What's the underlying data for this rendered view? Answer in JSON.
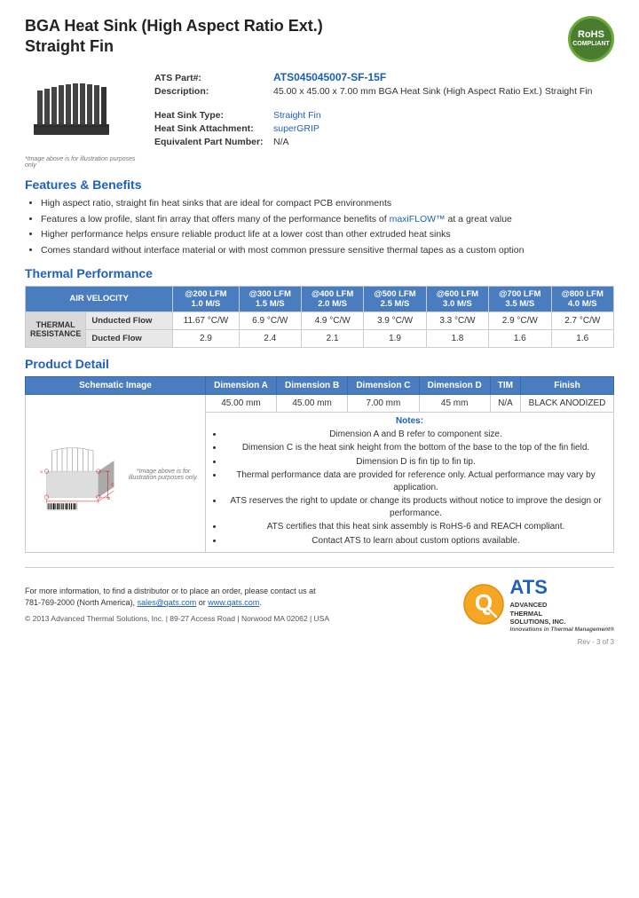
{
  "page": {
    "title_line1": "BGA Heat Sink (High Aspect Ratio Ext.)",
    "title_line2": "Straight Fin"
  },
  "rohs": {
    "line1": "RoHS",
    "line2": "COMPLIANT"
  },
  "product": {
    "part_label": "ATS Part#:",
    "part_number": "ATS045045007-SF-15F",
    "desc_label": "Description:",
    "description": "45.00 x 45.00 x 7.00 mm  BGA Heat Sink (High Aspect Ratio Ext.) Straight Fin",
    "type_label": "Heat Sink Type:",
    "type_value": "Straight Fin",
    "attach_label": "Heat Sink Attachment:",
    "attach_value": "superGRIP",
    "equiv_label": "Equivalent Part Number:",
    "equiv_value": "N/A",
    "image_caption": "*Image above is for illustration purposes only"
  },
  "features": {
    "section_title": "Features & Benefits",
    "items": [
      "High aspect ratio, straight fin heat sinks that are ideal for compact PCB environments",
      "Features a low profile, slant fin array that offers many of the performance benefits of maxiFLOW™ at a great value",
      "Higher performance helps ensure reliable product life at a lower cost than other extruded heat sinks",
      "Comes standard without interface material or with most common pressure sensitive thermal tapes as a custom option"
    ],
    "highlight_text": "maxiFLOW™"
  },
  "thermal": {
    "section_title": "Thermal Performance",
    "col_header_label": "AIR VELOCITY",
    "columns": [
      {
        "label": "@200 LFM",
        "sub": "1.0 M/S"
      },
      {
        "label": "@300 LFM",
        "sub": "1.5 M/S"
      },
      {
        "label": "@400 LFM",
        "sub": "2.0 M/S"
      },
      {
        "label": "@500 LFM",
        "sub": "2.5 M/S"
      },
      {
        "label": "@600 LFM",
        "sub": "3.0 M/S"
      },
      {
        "label": "@700 LFM",
        "sub": "3.5 M/S"
      },
      {
        "label": "@800 LFM",
        "sub": "4.0 M/S"
      }
    ],
    "row_label": "THERMAL RESISTANCE",
    "rows": [
      {
        "label": "Unducted Flow",
        "values": [
          "11.67 °C/W",
          "6.9 °C/W",
          "4.9 °C/W",
          "3.9 °C/W",
          "3.3 °C/W",
          "2.9 °C/W",
          "2.7 °C/W"
        ]
      },
      {
        "label": "Ducted Flow",
        "values": [
          "2.9",
          "2.4",
          "2.1",
          "1.9",
          "1.8",
          "1.6",
          "1.6"
        ]
      }
    ]
  },
  "product_detail": {
    "section_title": "Product Detail",
    "table_headers": [
      "Schematic Image",
      "Dimension A",
      "Dimension B",
      "Dimension C",
      "Dimension D",
      "TIM",
      "Finish"
    ],
    "dim_a": "45.00 mm",
    "dim_b": "45.00 mm",
    "dim_c": "7.00 mm",
    "dim_d": "45 mm",
    "tim": "N/A",
    "finish": "BLACK ANODIZED",
    "notes_title": "Notes:",
    "notes": [
      "Dimension A and B refer to component size.",
      "Dimension C is the heat sink height from the bottom of the base to the top of the fin field.",
      "Dimension D is fin tip to fin tip.",
      "Thermal performance data are provided for reference only. Actual performance may vary by application.",
      "ATS reserves the right to update or change its products without notice to improve the design or performance.",
      "ATS certifies that this heat sink assembly is RoHS-6 and REACH compliant.",
      "Contact ATS to learn about custom options available."
    ],
    "schematic_caption": "*Image above is for illustration purposes only."
  },
  "footer": {
    "contact_text": "For more information, to find a distributor or to place an order, please contact us at",
    "phone": "781-769-2000 (North America),",
    "email": "sales@qats.com",
    "email_connector": "or",
    "website": "www.qats.com",
    "copyright": "© 2013 Advanced Thermal Solutions, Inc.  |  89-27 Access Road  |  Norwood MA  02062  |  USA",
    "company_name": "ADVANCED\nTHERMAL\nSOLUTIONS, INC.",
    "company_tagline": "Innovations in Thermal Management®",
    "page_number": "Rev - 3 of 3"
  }
}
